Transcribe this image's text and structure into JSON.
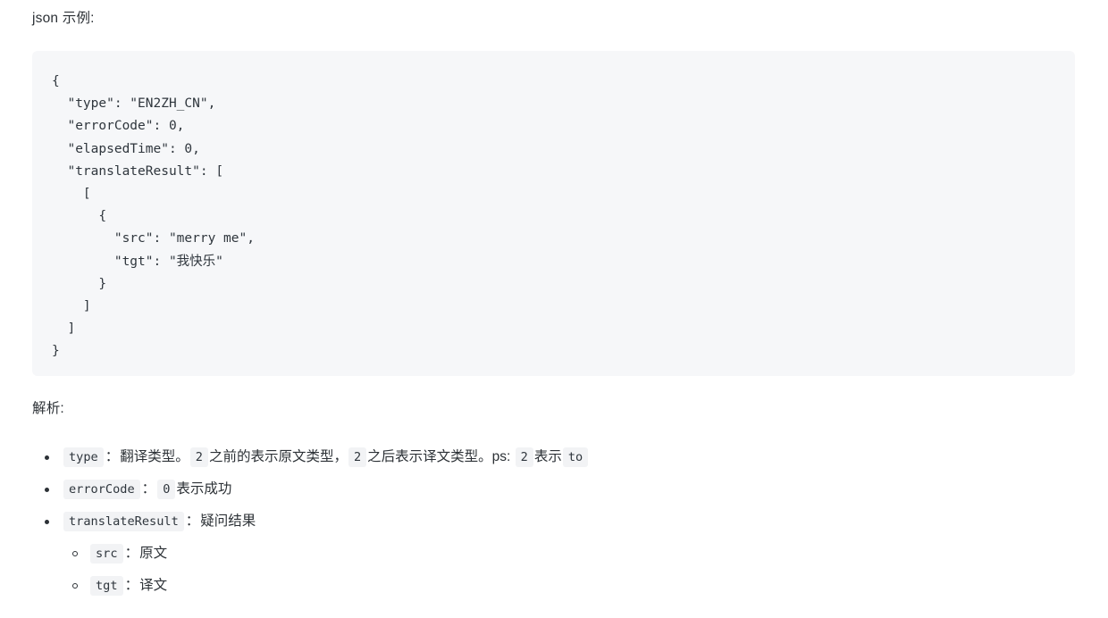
{
  "document": {
    "heading_json_example": "json 示例:",
    "heading_analysis": "解析:"
  },
  "code_block": {
    "language": "json",
    "background": "#f6f7f9",
    "text_color": "#2f363d",
    "content": "{\n  \"type\": \"EN2ZH_CN\",\n  \"errorCode\": 0,\n  \"elapsedTime\": 0,\n  \"translateResult\": [\n    [\n      {\n        \"src\": \"merry me\",\n        \"tgt\": \"我快乐\"\n      }\n    ]\n  ]\n}",
    "lines": [
      "{",
      "  \"type\": \"EN2ZH_CN\",",
      "  \"errorCode\": 0,",
      "  \"elapsedTime\": 0,",
      "  \"translateResult\": [",
      "    [",
      "      {",
      "        \"src\": \"merry me\",",
      "        \"tgt\": \"我快乐\"",
      "      }",
      "    ]",
      "  ]",
      "}"
    ],
    "json_value": {
      "type": "EN2ZH_CN",
      "errorCode": 0,
      "elapsedTime": 0,
      "translateResult": [
        [
          {
            "src": "merry me",
            "tgt": "我快乐"
          }
        ]
      ]
    }
  },
  "analysis_list": {
    "items": [
      {
        "code": "type",
        "colon": "：",
        "segments": [
          {
            "kind": "text",
            "value": "翻译类型。"
          },
          {
            "kind": "code",
            "value": "2"
          },
          {
            "kind": "text",
            "value": "之前的表示原文类型，"
          },
          {
            "kind": "code",
            "value": "2"
          },
          {
            "kind": "text",
            "value": "之后表示译文类型。ps: "
          },
          {
            "kind": "code",
            "value": "2"
          },
          {
            "kind": "text",
            "value": "表示"
          },
          {
            "kind": "code",
            "value": "to"
          }
        ]
      },
      {
        "code": "errorCode",
        "colon": "：",
        "segments": [
          {
            "kind": "code",
            "value": "0"
          },
          {
            "kind": "text",
            "value": "表示成功"
          }
        ]
      },
      {
        "code": "translateResult",
        "colon": "：",
        "segments": [
          {
            "kind": "text",
            "value": "疑问结果"
          }
        ],
        "children": [
          {
            "code": "src",
            "colon": "：",
            "segments": [
              {
                "kind": "text",
                "value": "原文"
              }
            ]
          },
          {
            "code": "tgt",
            "colon": "：",
            "segments": [
              {
                "kind": "text",
                "value": "译文"
              }
            ]
          }
        ]
      }
    ]
  },
  "colors": {
    "page_background": "#ffffff",
    "body_text": "#2c3136",
    "code_block_background": "#f6f7f9",
    "inline_code_background": "#f2f3f5",
    "code_text": "#2f363d"
  }
}
